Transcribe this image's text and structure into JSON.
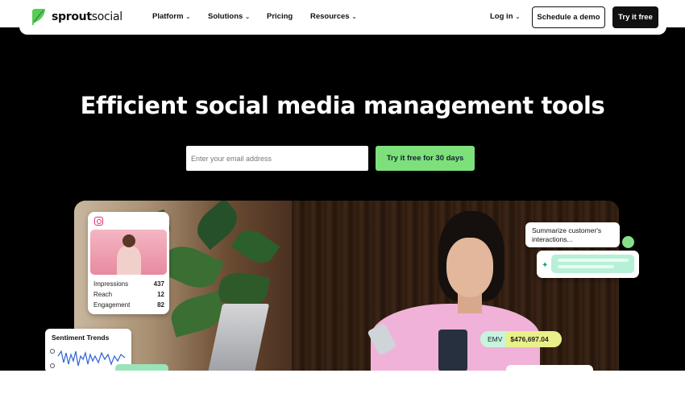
{
  "nav": {
    "logo_bold": "sprout",
    "logo_light": "social",
    "items": [
      {
        "label": "Platform",
        "caret": "⌄"
      },
      {
        "label": "Solutions",
        "caret": "⌄"
      },
      {
        "label": "Pricing"
      },
      {
        "label": "Resources",
        "caret": "⌄"
      }
    ],
    "login": "Log in",
    "login_caret": "⌄",
    "schedule_demo": "Schedule a demo",
    "try_free": "Try it free"
  },
  "hero": {
    "headline": "Efficient social media management tools",
    "email_placeholder": "Enter your email address",
    "cta": "Try it free for 30 days"
  },
  "instagram_card": {
    "icon": "instagram-icon",
    "stats": [
      {
        "label": "Impressions",
        "value": "437"
      },
      {
        "label": "Reach",
        "value": "12"
      },
      {
        "label": "Engagement",
        "value": "82"
      }
    ]
  },
  "sentiment_card": {
    "title": "Sentiment Trends"
  },
  "summary_card": {
    "text": "Summarize customer's interactions..."
  },
  "emv_chip": {
    "label": "EMV",
    "value": "$476,697.04"
  },
  "colors": {
    "brand_green": "#59cb59",
    "cta_green": "#7ee07a",
    "hero_bg": "#000000",
    "instagram_pink": "#e1306c"
  }
}
